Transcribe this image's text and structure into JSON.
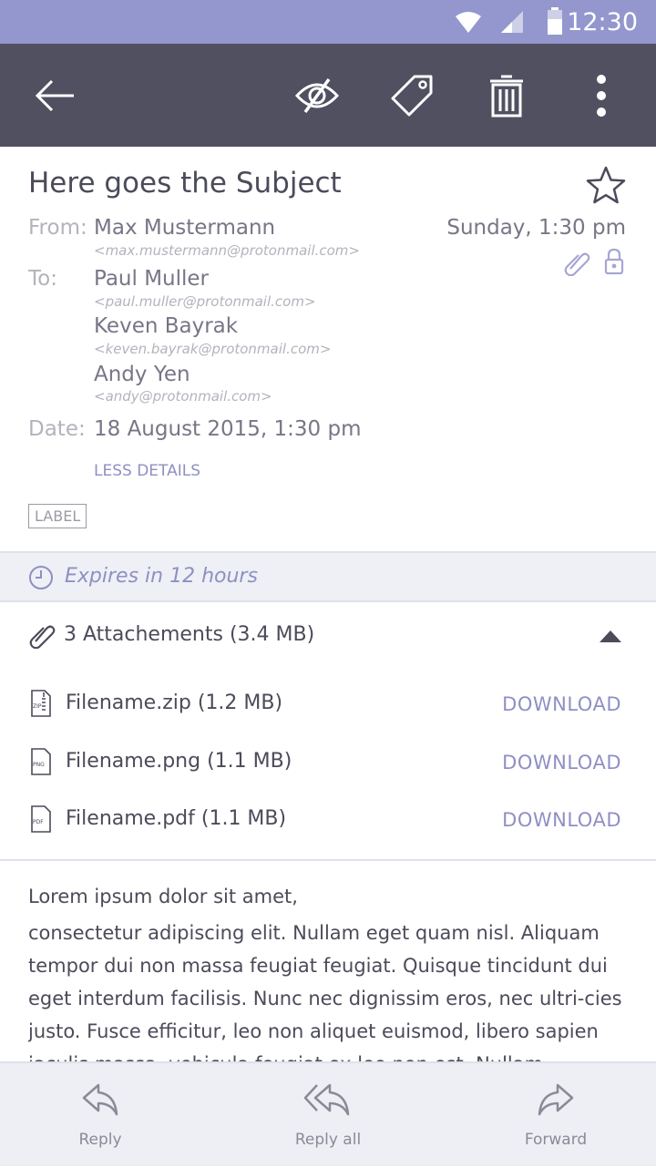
{
  "status_bar": {
    "time": "12:30"
  },
  "toolbar": {
    "icons": [
      "back-arrow-icon",
      "hide-eye-icon",
      "tag-icon",
      "trash-icon",
      "more-vert-icon"
    ]
  },
  "message": {
    "subject": "Here goes the Subject",
    "from_label": "From:",
    "from_name": "Max Mustermann",
    "from_email": "<max.mustermann@protonmail.com>",
    "to_label": "To:",
    "recipients": [
      {
        "name": "Paul Muller",
        "email": "<paul.muller@protonmail.com>"
      },
      {
        "name": "Keven Bayrak",
        "email": "<keven.bayrak@protonmail.com>"
      },
      {
        "name": "Andy Yen",
        "email": "<andy@protonmail.com>"
      }
    ],
    "date_label": "Date:",
    "date_value": "18 August 2015, 1:30 pm",
    "date_short": "Sunday, 1:30 pm",
    "less_details": "LESS DETAILS",
    "label": "LABEL"
  },
  "expires": {
    "text": "Expires in 12 hours"
  },
  "attachments": {
    "title": "3 Attachements (3.4 MB)",
    "files": [
      {
        "name": "Filename.zip (1.2 MB)",
        "type": "ZIP",
        "action": "DOWNLOAD"
      },
      {
        "name": "Filename.png (1.1 MB)",
        "type": "PNG",
        "action": "DOWNLOAD"
      },
      {
        "name": "Filename.pdf (1.1 MB)",
        "type": "PDF",
        "action": "DOWNLOAD"
      }
    ]
  },
  "body": {
    "first_line": "Lorem ipsum dolor sit amet,",
    "text": "consectetur adipiscing elit. Nullam eget quam nisl. Aliquam tempor dui non massa feugiat feugiat. Quisque tincidunt dui eget interdum facilisis. Nunc nec dignissim eros, nec ultri-cies justo. Fusce efficitur, leo non aliquet euismod, libero sapien iaculis massa, vehicula feugiat ex leo non est. Nullam"
  },
  "bottom_bar": {
    "reply": "Reply",
    "reply_all": "Reply all",
    "forward": "Forward"
  },
  "colors": {
    "accent": "#8f8fc4",
    "toolbar": "#505061",
    "status_bar": "#9397cd"
  }
}
